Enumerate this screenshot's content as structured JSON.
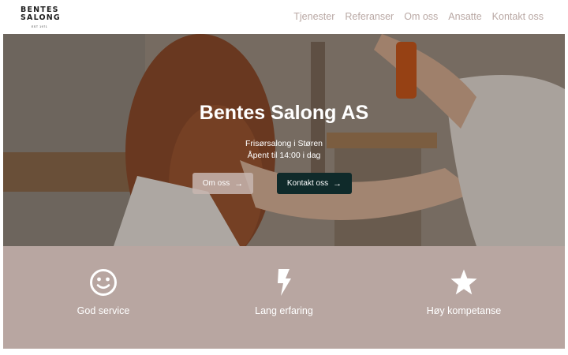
{
  "header": {
    "logo_line1": "BENTES",
    "logo_line2": "SALONG",
    "logo_line3": "EST 1971",
    "nav": [
      "Tjenester",
      "Referanser",
      "Om oss",
      "Ansatte",
      "Kontakt oss"
    ]
  },
  "hero": {
    "title": "Bentes Salong AS",
    "subtitle": "Frisørsalong i Støren",
    "hours": "Åpent til 14:00 i dag",
    "btn_about": "Om oss",
    "btn_contact": "Kontakt oss",
    "arrow": "→"
  },
  "features": [
    {
      "label": "God service",
      "icon": "smile-icon"
    },
    {
      "label": "Lang erfaring",
      "icon": "lightning-icon"
    },
    {
      "label": "Høy kompetanse",
      "icon": "star-icon"
    }
  ],
  "colors": {
    "nav_text": "#b9a8a4",
    "feature_bg": "#b8a6a1",
    "contact_button": "#0f2a2a",
    "about_button": "#c8b6b0"
  }
}
